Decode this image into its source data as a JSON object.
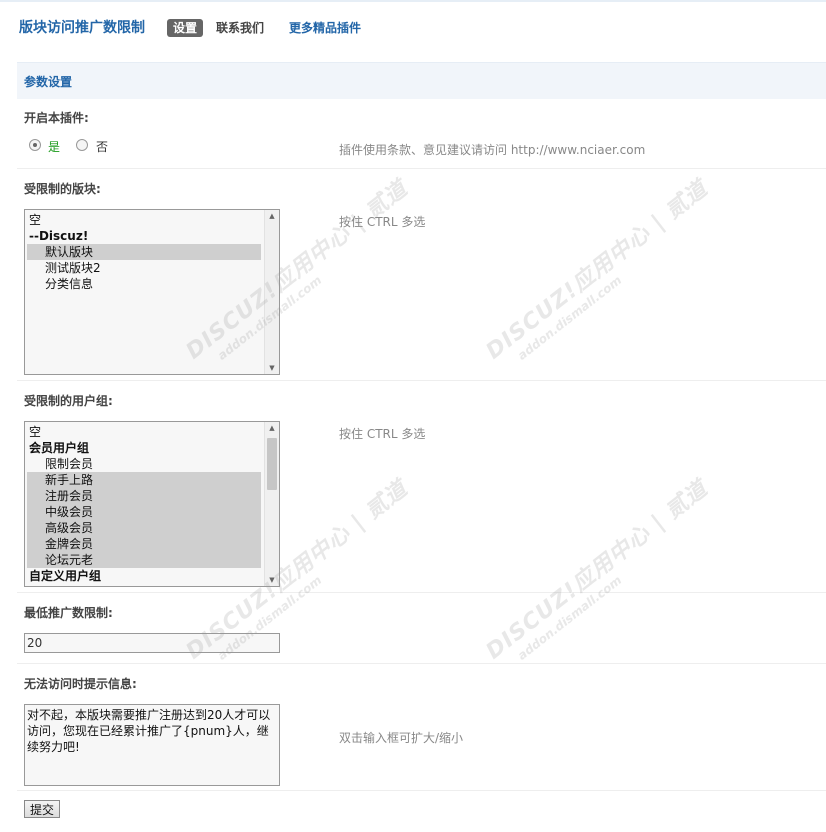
{
  "nav": {
    "title": "版块访问推广数限制",
    "tabs": [
      "设置",
      "联系我们",
      "更多精品插件"
    ]
  },
  "section": {
    "title": "参数设置"
  },
  "fields": {
    "enable": {
      "label": "开启本插件:",
      "options": [
        "是",
        "否"
      ],
      "selected": "是",
      "tip": "插件使用条款、意见建议请访问 http://www.nciaer.com"
    },
    "forums": {
      "label": "受限制的版块:",
      "tip": "按住 CTRL 多选",
      "options": [
        {
          "text": "空",
          "type": "normal",
          "selected": false
        },
        {
          "text": "--Discuz!",
          "type": "group",
          "selected": false
        },
        {
          "text": "默认版块",
          "type": "child",
          "selected": true
        },
        {
          "text": "测试版块2",
          "type": "child",
          "selected": false
        },
        {
          "text": "分类信息",
          "type": "child",
          "selected": false
        }
      ]
    },
    "usergroups": {
      "label": "受限制的用户组:",
      "tip": "按住 CTRL 多选",
      "options": [
        {
          "text": "空",
          "type": "normal",
          "selected": false
        },
        {
          "text": "会员用户组",
          "type": "group",
          "selected": false
        },
        {
          "text": "限制会员",
          "type": "child",
          "selected": false
        },
        {
          "text": "新手上路",
          "type": "child",
          "selected": true
        },
        {
          "text": "注册会员",
          "type": "child",
          "selected": true
        },
        {
          "text": "中级会员",
          "type": "child",
          "selected": true
        },
        {
          "text": "高级会员",
          "type": "child",
          "selected": true
        },
        {
          "text": "金牌会员",
          "type": "child",
          "selected": true
        },
        {
          "text": "论坛元老",
          "type": "child",
          "selected": true
        },
        {
          "text": "自定义用户组",
          "type": "group",
          "selected": false
        }
      ]
    },
    "min_promotion": {
      "label": "最低推广数限制:",
      "value": "20"
    },
    "message": {
      "label": "无法访问时提示信息:",
      "value": "对不起，本版块需要推广注册达到20人才可以访问，您现在已经累计推广了{pnum}人，继续努力吧!",
      "tip": "双击输入框可扩大/缩小"
    }
  },
  "submit": {
    "label": "提交"
  },
  "watermark": {
    "brand": "DISCUZ!应用中心 | 贰道",
    "url": "addon.dismall.com"
  },
  "colors": {
    "accent": "#2366a8",
    "header_bg": "#f1f5fa",
    "active_tab": "#666666",
    "yes_label": "#1a9a1a"
  }
}
